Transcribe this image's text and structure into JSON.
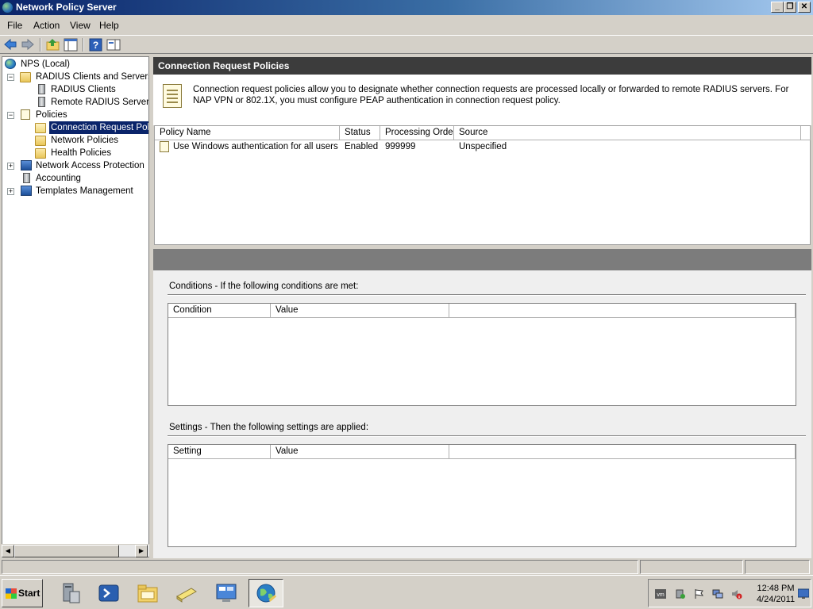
{
  "window": {
    "title": "Network Policy Server"
  },
  "menu": [
    "File",
    "Action",
    "View",
    "Help"
  ],
  "tree": {
    "root": "NPS (Local)",
    "radius_group": "RADIUS Clients and Servers",
    "radius_clients": "RADIUS Clients",
    "remote_groups": "Remote RADIUS Server G",
    "policies": "Policies",
    "connection_request": "Connection Request Polici",
    "network_policies": "Network Policies",
    "health_policies": "Health Policies",
    "nap": "Network Access Protection",
    "accounting": "Accounting",
    "templates": "Templates Management"
  },
  "pane": {
    "header": "Connection Request Policies",
    "description": "Connection request policies allow you to designate whether connection requests are processed locally or forwarded to remote RADIUS servers. For NAP VPN or 802.1X, you must configure PEAP authentication in connection request policy."
  },
  "policy_table": {
    "columns": [
      "Policy Name",
      "Status",
      "Processing Order",
      "Source"
    ],
    "rows": [
      {
        "name": "Use Windows authentication for all users",
        "status": "Enabled",
        "order": "999999",
        "source": "Unspecified"
      }
    ]
  },
  "conditions": {
    "title": "Conditions - If the following conditions are met:",
    "columns": [
      "Condition",
      "Value"
    ]
  },
  "settings": {
    "title": "Settings - Then the following settings are applied:",
    "columns": [
      "Setting",
      "Value"
    ]
  },
  "taskbar": {
    "start": "Start",
    "time": "12:48 PM",
    "date": "4/24/2011"
  },
  "colors": {
    "title_start": "#0a246a",
    "pane_header": "#3c3c3c",
    "selection": "#0a246a"
  }
}
